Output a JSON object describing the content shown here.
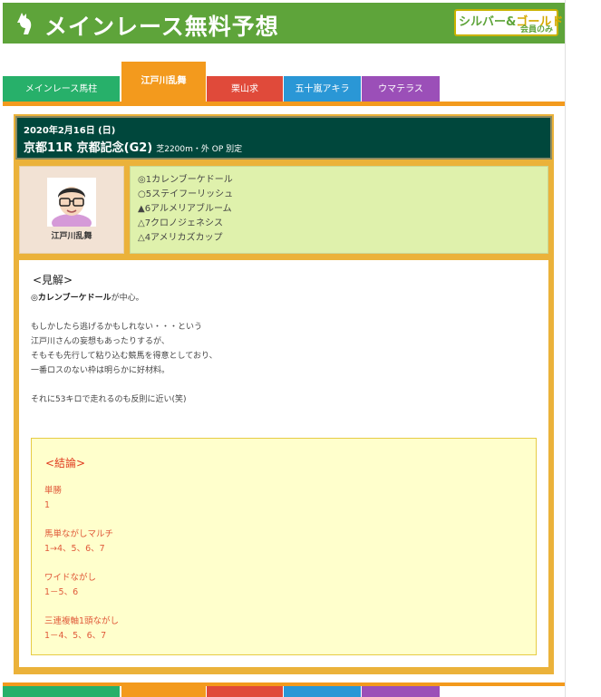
{
  "header": {
    "title": "メインレース無料予想",
    "badge_main_a": "シルバー&",
    "badge_main_b": "ゴールド",
    "badge_sub": "会員のみ"
  },
  "tabs": [
    {
      "label": "メインレース馬柱",
      "color": "#27b06a",
      "active": false
    },
    {
      "label": "江戸川乱舞",
      "color": "#f39a1d",
      "active": true
    },
    {
      "label": "栗山求",
      "color": "#e04a3a",
      "active": false
    },
    {
      "label": "五十嵐アキラ",
      "color": "#2a97d6",
      "active": false
    },
    {
      "label": "ウマテラス",
      "color": "#9b4fb8",
      "active": false
    }
  ],
  "race": {
    "date": "2020年2月16日 (日)",
    "name": "京都11R 京都記念(G2)",
    "detail": "芝2200m・外 OP 別定"
  },
  "forecaster": {
    "name": "江戸川乱舞"
  },
  "picks": [
    "◎1カレンブーケドール",
    "○5ステイフーリッシュ",
    "▲6アルメリアブルーム",
    "△7クロノジェネシス",
    "△4アメリカズカップ"
  ],
  "view": {
    "title": "<見解>",
    "lead_bold": "◎カレンブーケドール",
    "lead_rest": "が中心。",
    "lines": [
      "",
      "もしかしたら逃げるかもしれない・・・という",
      "江戸川さんの妄想もあったりするが、",
      "そもそも先行して粘り込む競馬を得意としており、",
      "一番ロスのない枠は明らかに好材料。",
      "",
      "それに53キロで走れるのも反則に近い(笑)"
    ]
  },
  "conclusion": {
    "title": "<結論>",
    "items": [
      {
        "label": "単勝",
        "value": "1"
      },
      {
        "label": "馬単ながしマルチ",
        "value": "1→4、5、6、7"
      },
      {
        "label": "ワイドながし",
        "value": "1－5、6"
      },
      {
        "label": "三連複軸1頭ながし",
        "value": "1－4、5、6、7"
      }
    ]
  },
  "colors": {
    "header_green": "#5ea43a",
    "tab_orange": "#f39a1d",
    "race_dark": "#00473c",
    "picks_bg": "#dff1ac",
    "conclusion_text": "#e05a3a"
  }
}
